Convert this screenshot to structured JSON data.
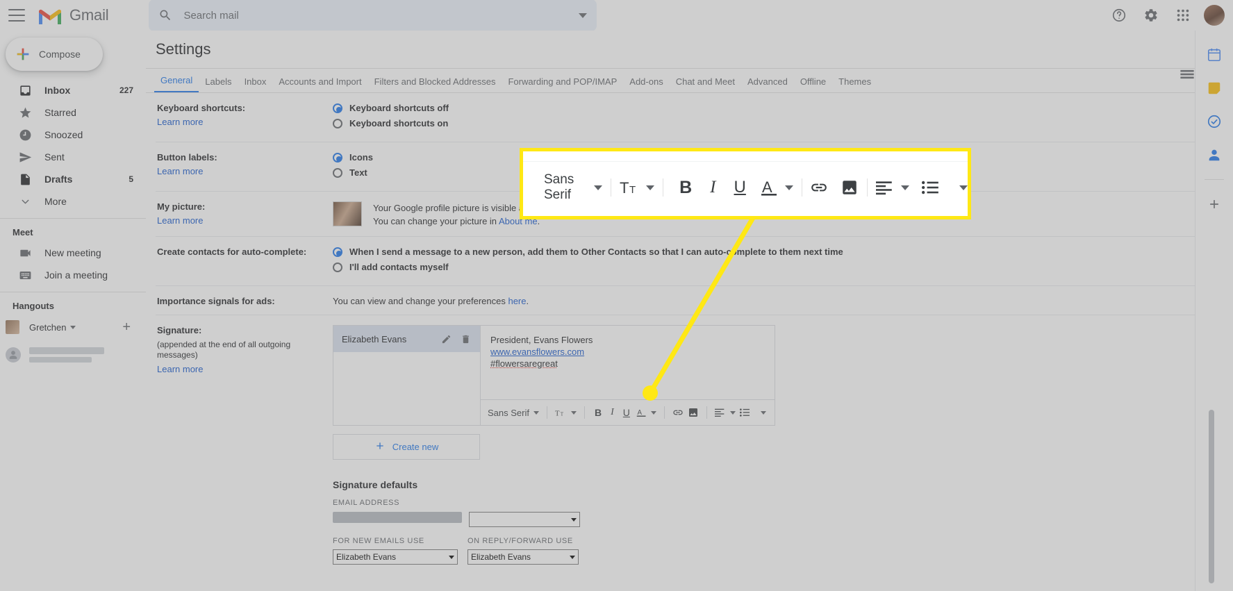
{
  "app": {
    "brand": "Gmail",
    "hamburger_icon": "hamburger-menu-icon",
    "logo_icon": "gmail-logo-icon"
  },
  "search": {
    "placeholder": "Search mail",
    "value": "",
    "icon": "search-icon",
    "options_icon": "chevron-down-icon"
  },
  "topbar_actions": {
    "help": "help-icon",
    "settings": "gear-icon",
    "apps": "apps-grid-icon",
    "account_avatar": "user-avatar"
  },
  "sidebar": {
    "compose": {
      "label": "Compose",
      "icon": "plus-icon"
    },
    "items": [
      {
        "label": "Inbox",
        "count": "227",
        "icon": "inbox-icon",
        "bold": true
      },
      {
        "label": "Starred",
        "count": "",
        "icon": "star-icon",
        "bold": false
      },
      {
        "label": "Snoozed",
        "count": "",
        "icon": "clock-icon",
        "bold": false
      },
      {
        "label": "Sent",
        "count": "",
        "icon": "send-icon",
        "bold": false
      },
      {
        "label": "Drafts",
        "count": "5",
        "icon": "draft-icon",
        "bold": true
      },
      {
        "label": "More",
        "count": "",
        "icon": "chevron-down-icon",
        "bold": false
      }
    ],
    "meet": {
      "title": "Meet",
      "items": [
        {
          "label": "New meeting",
          "icon": "video-camera-icon"
        },
        {
          "label": "Join a meeting",
          "icon": "keyboard-icon"
        }
      ]
    },
    "hangouts": {
      "title": "Hangouts",
      "user": "Gretchen",
      "user_caret_icon": "caret-down-icon",
      "add_icon": "plus-icon"
    }
  },
  "settings": {
    "title": "Settings",
    "density_icon": "display-density-icon",
    "density_caret_icon": "caret-down-icon",
    "tabs": [
      {
        "label": "General",
        "active": true
      },
      {
        "label": "Labels",
        "active": false
      },
      {
        "label": "Inbox",
        "active": false
      },
      {
        "label": "Accounts and Import",
        "active": false
      },
      {
        "label": "Filters and Blocked Addresses",
        "active": false
      },
      {
        "label": "Forwarding and POP/IMAP",
        "active": false
      },
      {
        "label": "Add-ons",
        "active": false
      },
      {
        "label": "Chat and Meet",
        "active": false
      },
      {
        "label": "Advanced",
        "active": false
      },
      {
        "label": "Offline",
        "active": false
      },
      {
        "label": "Themes",
        "active": false
      }
    ],
    "rows": {
      "keyboard": {
        "label": "Keyboard shortcuts:",
        "learn_more": "Learn more",
        "options": [
          {
            "label": "Keyboard shortcuts off",
            "selected": true
          },
          {
            "label": "Keyboard shortcuts on",
            "selected": false
          }
        ]
      },
      "button_labels": {
        "label": "Button labels:",
        "learn_more": "Learn more",
        "options": [
          {
            "label": "Icons",
            "selected": true
          },
          {
            "label": "Text",
            "selected": false
          }
        ]
      },
      "my_picture": {
        "label": "My picture:",
        "learn_more": "Learn more",
        "line1": "Your Google profile picture is visible across Google services.",
        "line2_pre": "You can change your picture in ",
        "line2_link": "About me",
        "line2_post": "."
      },
      "contacts": {
        "label": "Create contacts for auto-complete:",
        "options": [
          {
            "label": "When I send a message to a new person, add them to Other Contacts so that I can auto-complete to them next time",
            "selected": true
          },
          {
            "label": "I'll add contacts myself",
            "selected": false
          }
        ]
      },
      "importance": {
        "label": "Importance signals for ads:",
        "text_pre": "You can view and change your preferences ",
        "link": "here",
        "text_post": "."
      },
      "signature": {
        "label": "Signature:",
        "sub": "(appended at the end of all outgoing messages)",
        "learn_more": "Learn more",
        "item_name": "Elizabeth Evans",
        "edit_icon": "pencil-icon",
        "delete_icon": "trash-icon",
        "content_line1": "President, Evans Flowers",
        "content_link": "www.evansflowers.com",
        "content_line3": "#flowersaregreat",
        "create_new": "Create new",
        "create_new_icon": "plus-icon"
      },
      "signature_defaults": {
        "title": "Signature defaults",
        "email_label": "EMAIL ADDRESS",
        "email_value": "",
        "new_emails_label": "FOR NEW EMAILS USE",
        "new_emails_value": "Elizabeth Evans",
        "reply_label": "ON REPLY/FORWARD USE",
        "reply_value": "Elizabeth Evans"
      }
    }
  },
  "editor_toolbar": {
    "font": "Sans Serif",
    "font_caret_icon": "caret-down-icon",
    "size_icon": "font-size-icon",
    "size_caret_icon": "caret-down-icon",
    "bold": "B",
    "italic": "I",
    "underline": "U",
    "text_color_icon": "text-color-icon",
    "text_color_caret_icon": "caret-down-icon",
    "link_icon": "link-icon",
    "image_icon": "insert-image-icon",
    "align_icon": "align-left-icon",
    "align_caret_icon": "caret-down-icon",
    "list_icon": "bulleted-list-icon",
    "more_icon": "caret-down-icon"
  },
  "callout": {
    "border_color": "#ffe815",
    "pointer_color": "#ffe815",
    "font": "Sans Serif"
  },
  "rail": {
    "items": [
      {
        "icon": "calendar-icon"
      },
      {
        "icon": "keep-notes-icon"
      },
      {
        "icon": "tasks-icon"
      },
      {
        "icon": "contacts-icon"
      },
      {
        "icon": "add-addon-icon"
      }
    ]
  }
}
